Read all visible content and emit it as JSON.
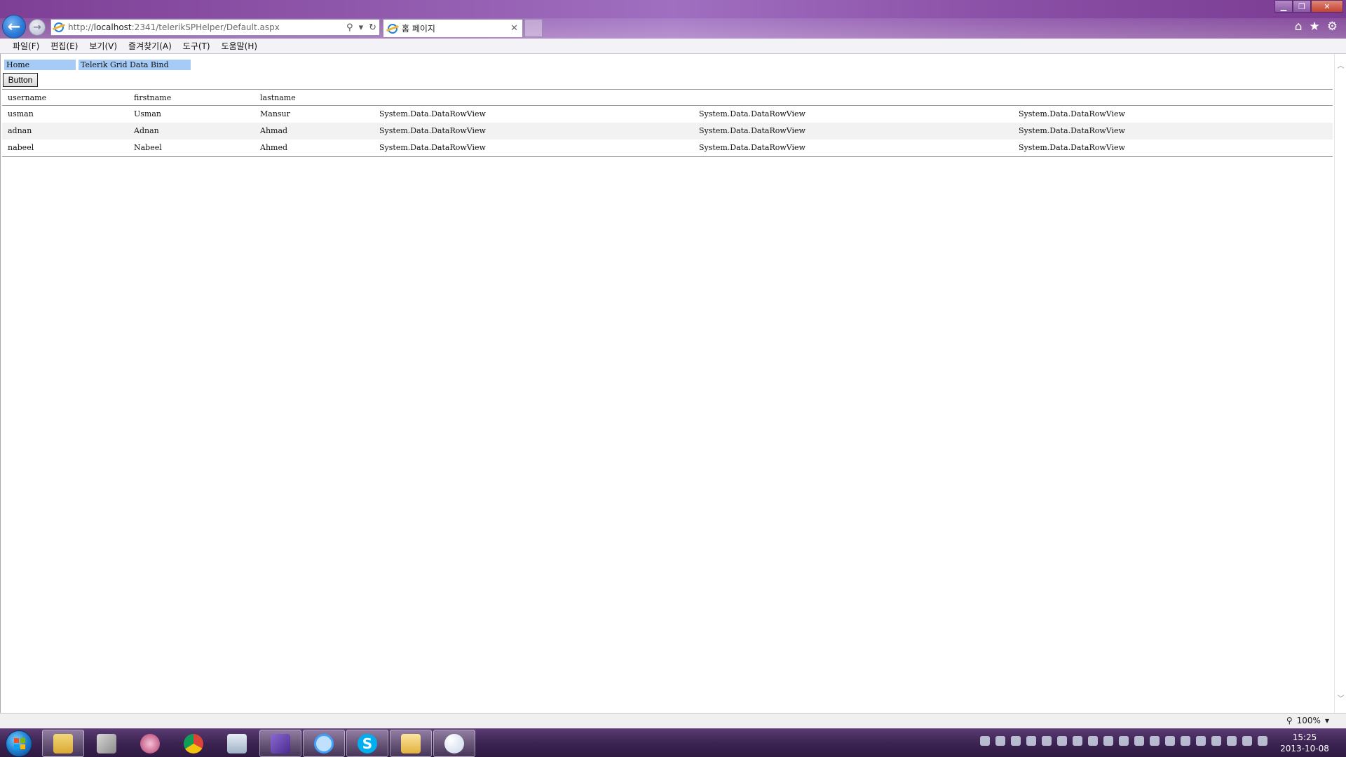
{
  "browser": {
    "address": {
      "prefix": "http://",
      "host": "localhost",
      "rest": ":2341/telerikSPHelper/Default.aspx"
    },
    "tab_title": "홈 페이지",
    "zoom": "100%"
  },
  "menu": {
    "items": [
      "파일(F)",
      "편집(E)",
      "보기(V)",
      "즐겨찾기(A)",
      "도구(T)",
      "도움말(H)"
    ]
  },
  "page": {
    "links": {
      "home": "Home",
      "telerik": "Telerik Grid Data Bind"
    },
    "button_label": "Button",
    "grid": {
      "headers": [
        "username",
        "firstname",
        "lastname",
        "",
        "",
        ""
      ],
      "rows": [
        [
          "usman",
          "Usman",
          "Mansur",
          "System.Data.DataRowView",
          "System.Data.DataRowView",
          "System.Data.DataRowView"
        ],
        [
          "adnan",
          "Adnan",
          "Ahmad",
          "System.Data.DataRowView",
          "System.Data.DataRowView",
          "System.Data.DataRowView"
        ],
        [
          "nabeel",
          "Nabeel",
          "Ahmed",
          "System.Data.DataRowView",
          "System.Data.DataRowView",
          "System.Data.DataRowView"
        ]
      ]
    }
  },
  "taskbar": {
    "clock_time": "15:25",
    "clock_date": "2013-10-08"
  },
  "colors": {
    "link_bg": "#a6cbf7",
    "titlebar": "#8e56aa",
    "taskbar": "#3c2452"
  }
}
